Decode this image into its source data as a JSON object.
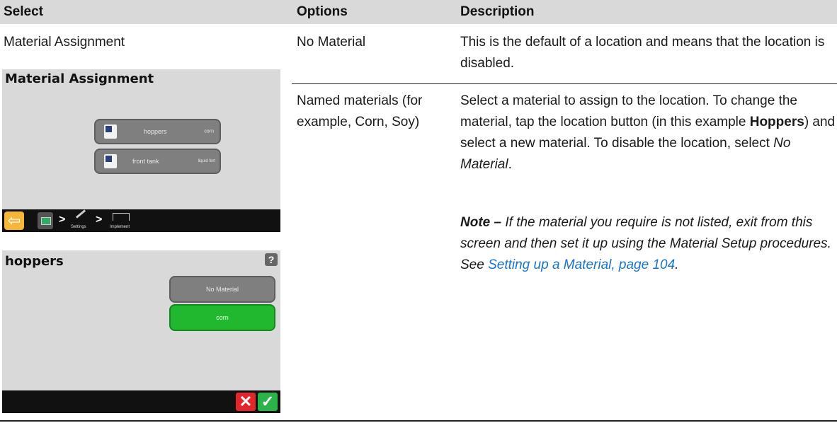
{
  "table": {
    "headers": {
      "select": "Select",
      "options": "Options",
      "description": "Description"
    },
    "rows": [
      {
        "select": "Material Assignment",
        "option": "No Material",
        "description": "This is the default of a location and means that the location is disabled."
      },
      {
        "option": "Named materials (for example, Corn, Soy)",
        "description_parts": {
          "p1_a": "Select a material to assign to the location. To change the material, tap the location button (in this example ",
          "p1_b": "Hoppers",
          "p1_c": ") and select a new material. To disable the location, select ",
          "p1_d": "No Material",
          "p1_e": ".",
          "note_label": "Note –",
          "note_text": " If the material you require is not listed, exit from this screen and then set it up using the Material Setup procedures. See ",
          "note_link": "Setting up a Material, page 104",
          "note_end": "."
        }
      }
    ]
  },
  "screen1": {
    "title": "Material Assignment",
    "buttons": [
      {
        "label": "hoppers",
        "value": "corn"
      },
      {
        "label": "front tank",
        "value": "liquid fert"
      }
    ],
    "nav": {
      "settings": "Settings",
      "implement": "Implement"
    }
  },
  "screen2": {
    "title": "hoppers",
    "help": "?",
    "options": [
      {
        "label": "No Material",
        "color": "#7f7f7f"
      },
      {
        "label": "corn",
        "color": "#21b82f"
      }
    ],
    "cancel_color": "#e2262c",
    "ok_color": "#2bb34a"
  }
}
